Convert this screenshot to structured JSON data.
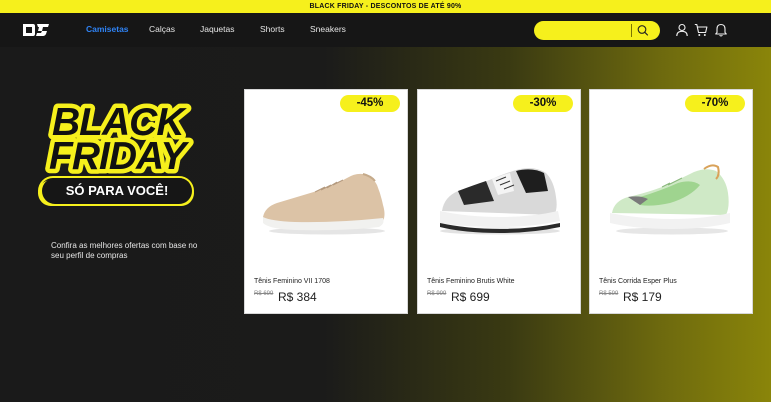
{
  "announcement": "BLACK FRIDAY - DESCONTOS DE ATÉ 90%",
  "nav": {
    "links": [
      "Camisetas",
      "Calças",
      "Jaquetas",
      "Shorts",
      "Sneakers"
    ],
    "active_index": 0,
    "search_placeholder": "",
    "icons": [
      "user-icon",
      "cart-icon",
      "bell-icon"
    ]
  },
  "hero": {
    "title_line1": "BLACK",
    "title_line2": "FRIDAY",
    "pill": "SÓ PARA VOCÊ!",
    "description": "Confira as melhores ofertas com base no seu perfil de compras"
  },
  "products": [
    {
      "discount": "-45%",
      "name": "Tênis Feminino VII 1708",
      "old_price": "R$ 699",
      "price": "R$ 384",
      "shoe_color": "beige"
    },
    {
      "discount": "-30%",
      "name": "Tênis Feminino Brutis White",
      "old_price": "R$ 999",
      "price": "R$ 699",
      "shoe_color": "black-white"
    },
    {
      "discount": "-70%",
      "name": "Tênis Corrida Esper Plus",
      "old_price": "R$ 599",
      "price": "R$ 179",
      "shoe_color": "mint-green"
    }
  ],
  "colors": {
    "accent_yellow": "#f6f01c",
    "nav_background": "#161616",
    "active_link": "#2f83f5"
  }
}
